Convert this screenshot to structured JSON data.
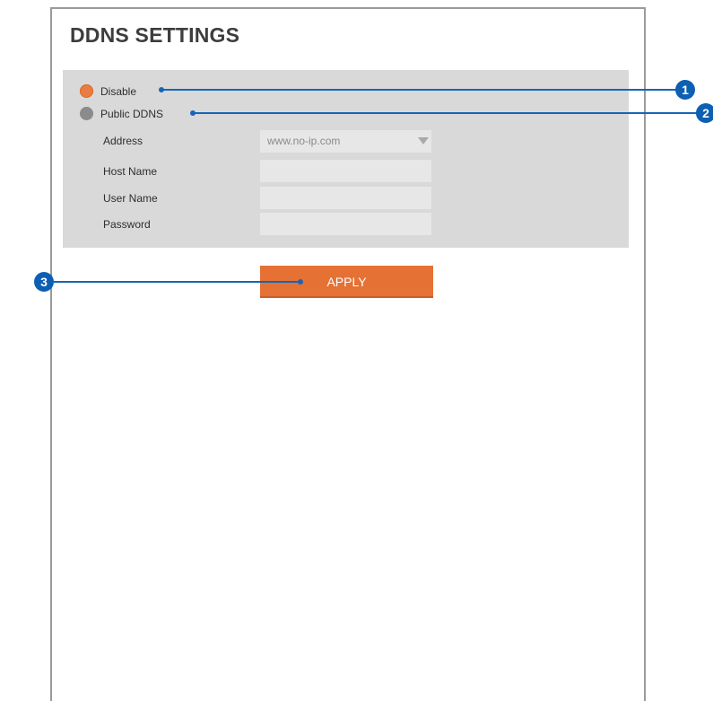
{
  "title": "DDNS SETTINGS",
  "ddns_mode": {
    "options": [
      {
        "label": "Disable",
        "selected": true
      },
      {
        "label": "Public DDNS",
        "selected": false
      }
    ]
  },
  "fields": {
    "address_label": "Address",
    "address_value": "www.no-ip.com",
    "host_name_label": "Host Name",
    "host_name_value": "",
    "user_name_label": "User Name",
    "user_name_value": "",
    "password_label": "Password",
    "password_value": ""
  },
  "apply_label": "APPLY",
  "callouts": [
    "1",
    "2",
    "3"
  ],
  "colors": {
    "accent": "#e57135",
    "selected_radio": "#e97c42",
    "unselected_radio": "#8b8b8b",
    "callout": "#0d5fb3",
    "panel_bg": "#d9d9d9"
  }
}
